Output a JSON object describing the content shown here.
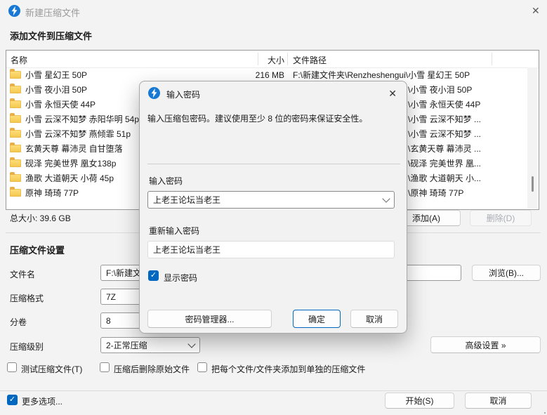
{
  "window": {
    "title": "新建压缩文件",
    "close_glyph": "✕"
  },
  "header": {
    "section_title": "添加文件到压缩文件"
  },
  "file_table": {
    "columns": [
      "名称",
      "大小",
      "文件路径"
    ],
    "rows": [
      {
        "name": "小雪 星幻王 50P",
        "size": "216 MB",
        "path": "F:\\新建文件夹\\Renzheshengui\\小雪 星幻王 50P"
      },
      {
        "name": "小雪 夜小泪 50P",
        "size": "",
        "path": "\\小雪 夜小泪 50P"
      },
      {
        "name": "小雪 永恒天使 44P",
        "size": "",
        "path": "\\小雪 永恒天使 44P"
      },
      {
        "name": "小雪 云深不知梦 赤阳华明 54p",
        "size": "",
        "path": "\\小雪 云深不知梦 ..."
      },
      {
        "name": "小雪 云深不知梦 燕倾霏 51p",
        "size": "",
        "path": "\\小雪 云深不知梦 ..."
      },
      {
        "name": "玄黄天尊 幕沛灵 自甘堕落",
        "size": "",
        "path": "\\玄黄天尊 幕沛灵 ..."
      },
      {
        "name": "砚泽 完美世界 凰女138p",
        "size": "",
        "path": "\\砚泽 完美世界 凰..."
      },
      {
        "name": "渔歌 大道朝天 小荷 45p",
        "size": "",
        "path": "\\渔歌 大道朝天 小..."
      },
      {
        "name": "原神 琦琦 77P",
        "size": "",
        "path": "\\原神 琦琦 77P"
      }
    ],
    "total_label": "总大小: 39.6 GB"
  },
  "actions": {
    "add_label": "添加(A)",
    "delete_label": "删除(D)"
  },
  "settings": {
    "section_title": "压缩文件设置",
    "filename_label": "文件名",
    "filename_value": "F:\\新建文",
    "browse_label": "浏览(B)...",
    "format_label": "压缩格式",
    "format_value": "7Z",
    "volume_label": "分卷",
    "volume_value": "8",
    "level_label": "压缩级别",
    "level_value": "2-正常压缩",
    "advanced_label": "高级设置 »",
    "checkbox_test": "测试压缩文件(T)",
    "checkbox_delete_original": "压缩后删除原始文件",
    "checkbox_separate": "把每个文件/文件夹添加到单独的压缩文件"
  },
  "footer": {
    "more_options_label": "更多选项...",
    "start_label": "开始(S)",
    "cancel_label": "取消",
    "check_glyph": "✓"
  },
  "dialog": {
    "title": "输入密码",
    "close_glyph": "✕",
    "description": "输入压缩包密码。建议使用至少 8 位的密码来保证安全性。",
    "password_label": "输入密码",
    "password_value": "上老王论坛当老王",
    "confirm_label": "重新输入密码",
    "confirm_value": "上老王论坛当老王",
    "show_password_label": "显示密码",
    "password_manager_label": "密码管理器...",
    "ok_label": "确定",
    "cancel_label": "取消",
    "check_glyph": "✓"
  },
  "colors": {
    "accent": "#0067c0",
    "app_icon_blue": "#1879d4",
    "folder_yellow": "#f4c74d"
  }
}
